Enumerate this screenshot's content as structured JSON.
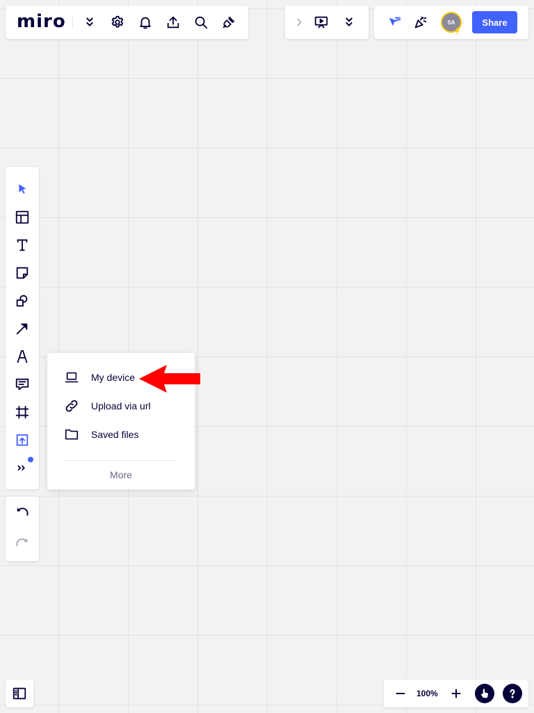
{
  "app": {
    "logo_text": "miro"
  },
  "top_left_toolbar": {
    "icons": [
      "chevron-double-down-icon",
      "gear-icon",
      "bell-icon",
      "upload-icon",
      "search-icon",
      "plug-icon"
    ]
  },
  "top_center_toolbar": {
    "icons": [
      "chevron-right-icon",
      "presentation-icon",
      "chevron-double-down-icon"
    ]
  },
  "top_right_toolbar": {
    "avatar_initials": "SA",
    "share_label": "Share",
    "colors": {
      "share_bg": "#4262ff",
      "accent": "#4262ff",
      "avatar_ring": "#fac710"
    }
  },
  "left_toolbar": {
    "tools": [
      "select-icon",
      "templates-icon",
      "text-icon",
      "sticky-note-icon",
      "shapes-icon",
      "arrow-line-icon",
      "pen-icon",
      "comment-icon",
      "frame-icon",
      "upload-icon",
      "more-tools-icon"
    ],
    "active_tool": "upload-icon"
  },
  "history_toolbar": {
    "icons": [
      "undo-icon",
      "redo-icon"
    ]
  },
  "upload_menu": {
    "items": [
      {
        "label": "My device",
        "icon": "laptop-icon"
      },
      {
        "label": "Upload via url",
        "icon": "link-icon"
      },
      {
        "label": "Saved files",
        "icon": "folder-icon"
      }
    ],
    "more_label": "More"
  },
  "annotation": {
    "arrow_color": "#ff0000"
  },
  "bottom_left": {
    "icon": "board-panel-icon"
  },
  "zoom_controls": {
    "zoom_level": "100%",
    "icons": [
      "zoom-out-icon",
      "zoom-in-icon",
      "hand-pointer-icon",
      "help-icon"
    ]
  }
}
